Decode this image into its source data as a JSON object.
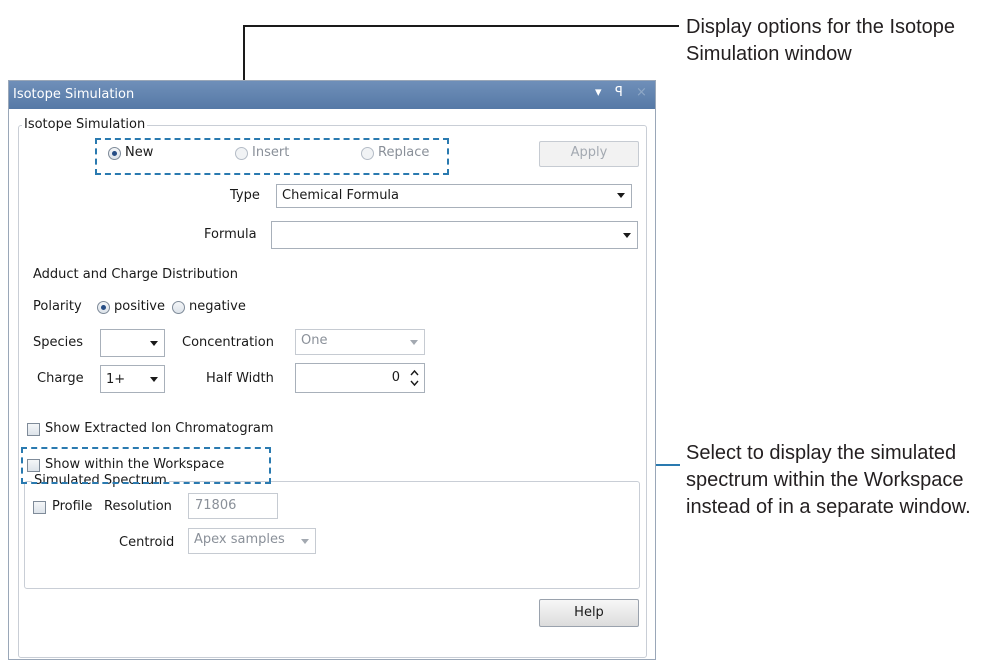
{
  "callouts": {
    "display_options": "Display options for the Isotope Simulation window",
    "workspace_note": "Select to display the simulated spectrum within the Workspace instead of in a separate window."
  },
  "window": {
    "title": "Isotope Simulation",
    "dropdown_icon": "▾",
    "pin_icon": "ꟼ",
    "close_icon": "×"
  },
  "isotope_group": {
    "label": "Isotope Simulation",
    "radio_new": "New",
    "radio_insert": "Insert",
    "radio_replace": "Replace",
    "apply_button": "Apply",
    "type_label": "Type",
    "type_value": "Chemical Formula",
    "formula_label": "Formula",
    "formula_value": ""
  },
  "adduct": {
    "heading": "Adduct and Charge Distribution",
    "polarity_label": "Polarity",
    "positive_label": "positive",
    "negative_label": "negative",
    "species_label": "Species",
    "species_value": "",
    "concentration_label": "Concentration",
    "concentration_value": "One",
    "charge_label": "Charge",
    "charge_value": "1+",
    "half_width_label": "Half Width",
    "half_width_value": "0"
  },
  "options": {
    "show_xic": "Show Extracted Ion Chromatogram",
    "show_workspace": "Show within the Workspace"
  },
  "simulated": {
    "label": "Simulated Spectrum",
    "profile_label": "Profile",
    "resolution_label": "Resolution",
    "resolution_value": "71806",
    "centroid_label": "Centroid",
    "centroid_value": "Apex samples"
  },
  "help_button": "Help",
  "colors": {
    "accent": "#2a7ab0",
    "titlebar": "#5f82ae"
  }
}
